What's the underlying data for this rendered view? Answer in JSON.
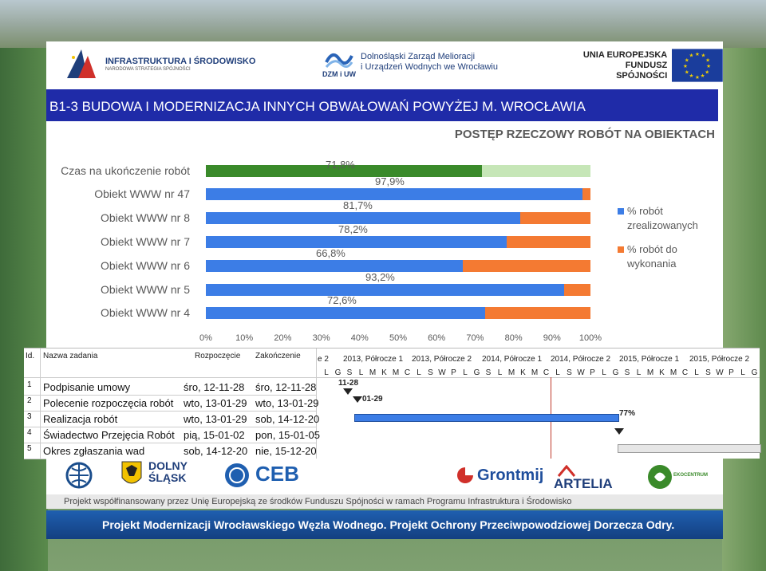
{
  "header": {
    "logos": {
      "left": {
        "name": "INFRASTRUKTURA I ŚRODOWISKO",
        "sub": "NARODOWA STRATEGIA SPÓJNOŚCI"
      },
      "center": {
        "line1": "Dolnośląski Zarząd Melioracji",
        "line2": "i Urządzeń Wodnych we Wrocławiu",
        "mark": "DZM i UW"
      },
      "right": {
        "line1": "UNIA EUROPEJSKA",
        "line2": "FUNDUSZ SPÓJNOŚCI"
      }
    },
    "title": "B1-3 BUDOWA I MODERNIZACJA INNYCH OBWAŁOWAŃ  POWYŻEJ M. WROCŁAWIA",
    "subtitle": "POSTĘP RZECZOWY ROBÓT NA OBIEKTACH"
  },
  "chart_data": {
    "type": "bar",
    "orientation": "horizontal",
    "stacked": true,
    "categories": [
      "Czas na ukończenie robót",
      "Obiekt WWW nr 47",
      "Obiekt WWW nr 8",
      "Obiekt WWW nr 7",
      "Obiekt WWW nr 6",
      "Obiekt WWW nr 5",
      "Obiekt WWW nr 4"
    ],
    "series": [
      {
        "name": "% robót zrealizowanych",
        "values": [
          71.8,
          97.9,
          81.7,
          78.2,
          66.8,
          93.2,
          72.6
        ]
      },
      {
        "name": "% robót do wykonania",
        "values": [
          28.2,
          2.1,
          18.3,
          21.8,
          33.2,
          6.8,
          27.4
        ]
      }
    ],
    "labels": [
      "71,8%",
      "97,9%",
      "81,7%",
      "78,2%",
      "66,8%",
      "93,2%",
      "72,6%"
    ],
    "xticks": [
      "0%",
      "10%",
      "20%",
      "30%",
      "40%",
      "50%",
      "60%",
      "70%",
      "80%",
      "90%",
      "100%"
    ],
    "xlim": [
      0,
      100
    ],
    "legend_position": "right",
    "colors": {
      "done": "#3c7de6",
      "remaining": "#f47a32",
      "time_done": "#3a8a2a",
      "time_remaining": "#c6e6b7"
    }
  },
  "gantt": {
    "headers": {
      "id": "Id.",
      "name": "Nazwa zadania",
      "start": "Rozpoczęcie",
      "end": "Zakończenie"
    },
    "periods": [
      "e 2",
      "2013, Półrocze 1",
      "2013, Półrocze 2",
      "2014, Półrocze 1",
      "2014, Półrocze 2",
      "2015, Półrocze 1",
      "2015, Półrocze 2"
    ],
    "months": [
      "L",
      "G",
      "S",
      "L",
      "M",
      "K",
      "M",
      "C",
      "L",
      "S",
      "W",
      "P",
      "L",
      "G",
      "S",
      "L",
      "M",
      "K",
      "M",
      "C",
      "L",
      "S",
      "W",
      "P",
      "L",
      "G",
      "S",
      "L",
      "M",
      "K",
      "M",
      "C",
      "L",
      "S",
      "W",
      "P",
      "L",
      "G"
    ],
    "tasks": [
      {
        "id": "1",
        "name": "Podpisanie umowy",
        "start": "śro, 12-11-28",
        "end": "śro, 12-11-28"
      },
      {
        "id": "2",
        "name": "Polecenie rozpoczęcia robót",
        "start": "wto, 13-01-29",
        "end": "wto, 13-01-29"
      },
      {
        "id": "3",
        "name": "Realizacja robót",
        "start": "wto, 13-01-29",
        "end": "sob, 14-12-20"
      },
      {
        "id": "4",
        "name": "Świadectwo Przejęcia Robót",
        "start": "pią, 15-01-02",
        "end": "pon, 15-01-05"
      },
      {
        "id": "5",
        "name": "Okres zgłaszania wad",
        "start": "sob, 14-12-20",
        "end": "nie, 15-12-20"
      }
    ],
    "markers": {
      "m1": "11-28",
      "m2": "01-29",
      "progress": "77%"
    }
  },
  "footer": {
    "logos": [
      "DOLNY ŚLĄSK",
      "CEB",
      "Grontmij",
      "ARTELIA",
      "EKOCENTRUM"
    ],
    "note": "Projekt współfinansowany przez Unię Europejską ze środków Funduszu Spójności w ramach Programu Infrastruktura i Środowisko",
    "band": "Projekt Modernizacji Wrocławskiego Węzła Wodnego. Projekt Ochrony Przeciwpowodziowej Dorzecza Odry."
  }
}
